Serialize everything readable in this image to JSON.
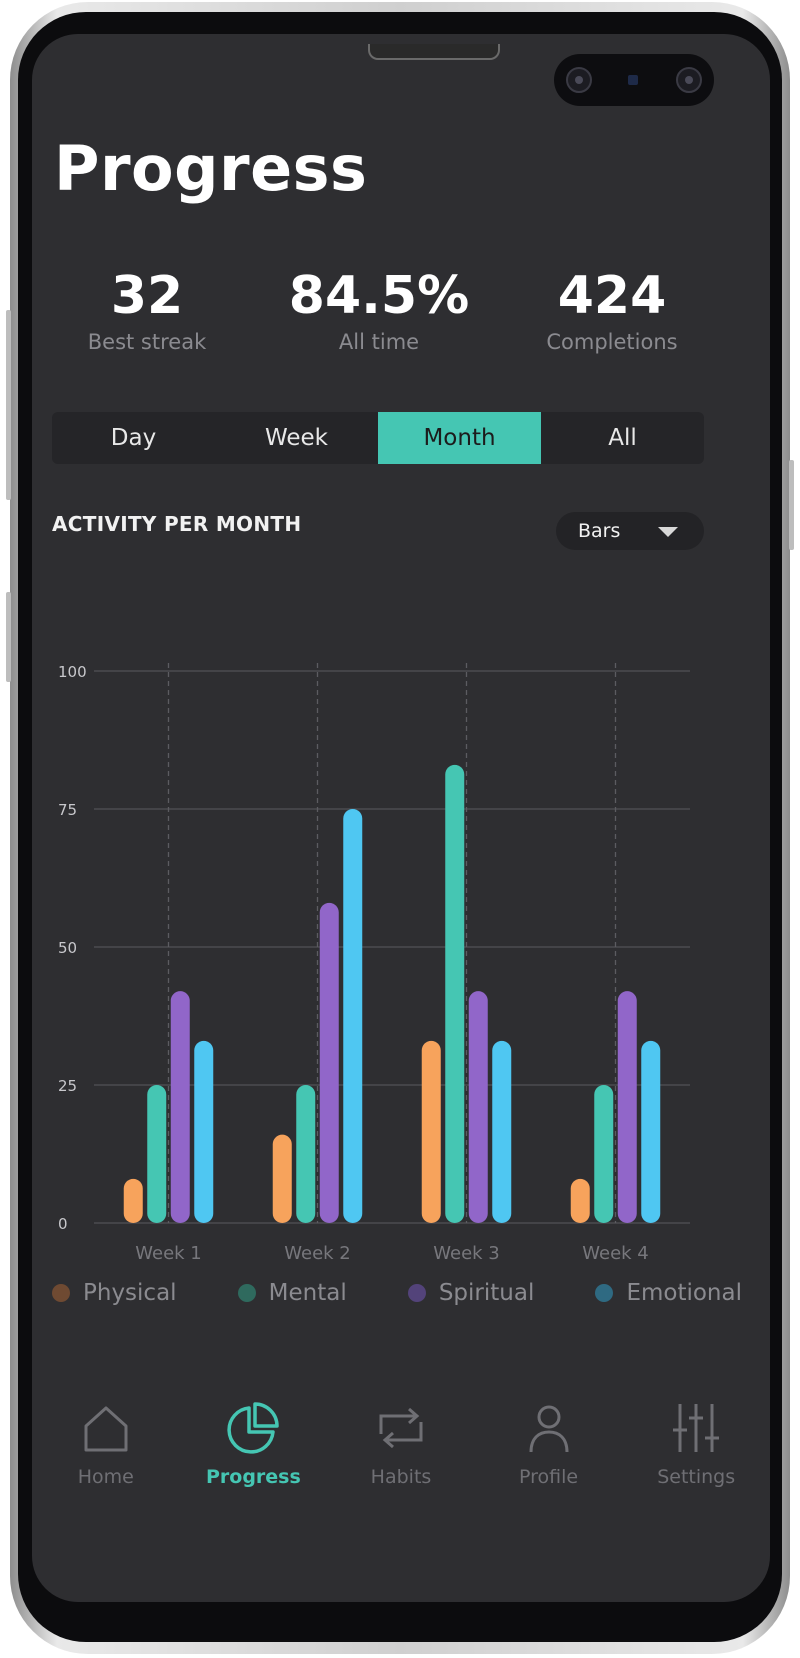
{
  "page": {
    "title": "Progress"
  },
  "stats": [
    {
      "value": "32",
      "label": "Best streak"
    },
    {
      "value": "84.5%",
      "label": "All time"
    },
    {
      "value": "424",
      "label": "Completions"
    }
  ],
  "segments": {
    "options": [
      "Day",
      "Week",
      "Month",
      "All"
    ],
    "active": "Month"
  },
  "chart_section": {
    "title": "ACTIVITY PER MONTH",
    "dropdown": {
      "selected": "Bars",
      "icon": "caret-down-icon"
    }
  },
  "colors": {
    "accent": "#45c6b3",
    "physical": "#f7a35c",
    "mental": "#45c6b3",
    "spiritual": "#9166c9",
    "emotional": "#4fc7f2",
    "background": "#2e2e31"
  },
  "chart_data": {
    "type": "bar",
    "title": "ACTIVITY PER MONTH",
    "categories": [
      "Week 1",
      "Week 2",
      "Week 3",
      "Week 4"
    ],
    "series": [
      {
        "name": "Physical",
        "color": "#f7a35c",
        "values": [
          8,
          16,
          33,
          8
        ]
      },
      {
        "name": "Mental",
        "color": "#45c6b3",
        "values": [
          25,
          25,
          83,
          25
        ]
      },
      {
        "name": "Spiritual",
        "color": "#9166c9",
        "values": [
          42,
          58,
          42,
          42
        ]
      },
      {
        "name": "Emotional",
        "color": "#4fc7f2",
        "values": [
          33,
          75,
          33,
          33
        ]
      }
    ],
    "ylim": [
      0,
      100
    ],
    "yticks": [
      0,
      25,
      50,
      75,
      100
    ],
    "xlabel": "",
    "ylabel": "",
    "grid": true,
    "legend": "bottom"
  },
  "legend": [
    "Physical",
    "Mental",
    "Spiritual",
    "Emotional"
  ],
  "tabbar": {
    "active": "Progress",
    "items": [
      {
        "label": "Home",
        "icon": "home-icon"
      },
      {
        "label": "Progress",
        "icon": "pie-chart-icon"
      },
      {
        "label": "Habits",
        "icon": "repeat-icon"
      },
      {
        "label": "Profile",
        "icon": "user-icon"
      },
      {
        "label": "Settings",
        "icon": "sliders-icon"
      }
    ]
  }
}
